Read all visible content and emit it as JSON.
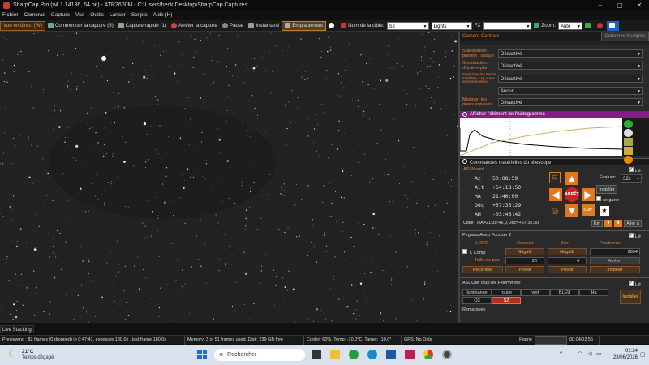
{
  "window": {
    "title": "SharpCap Pro (v4.1.14136, 64 bit) - ATR2600M - C:\\Users\\beck\\Desktop\\SharpCap Captures"
  },
  "menu": [
    "Fichier",
    "Caméras",
    "Capture",
    "Vue",
    "Outils",
    "Lancer",
    "Scripts",
    "Aide (H)"
  ],
  "toolbar": {
    "live_view": "Vue en direct (W)",
    "start_capture": "Commencer la capture (5)",
    "quick_capture": "Capture rapide (1)",
    "stop_capture": "Arrêter la capture",
    "pause": "Pause",
    "snapshot": "Instantané",
    "location": "Emplacement",
    "target_label": "Nom de la cible:",
    "target_value": "S2",
    "frame_type": "Lights",
    "fx_label": "FX",
    "zoom_label": "Zoom:",
    "zoom_value": "Auto"
  },
  "camera_controls": {
    "title": "Camera Controls",
    "multi_columns": "Colonnes multiples",
    "rows": [
      {
        "label": "Stabilisation planète / disque",
        "value": "Désactivé"
      },
      {
        "label": "Soustraction d'arrière-plan",
        "value": "Désactivé"
      },
      {
        "label": "Supprimer les traces satellites + sp upres la tombée de la",
        "value": "Désactivé"
      },
      {
        "label": "",
        "value": "Aucun"
      },
      {
        "label": "Masquer les pixels exposés",
        "value": "Désactivé"
      }
    ]
  },
  "histogram": {
    "title": "Afficher l'élément de l'histogramme"
  },
  "telescope": {
    "title": "Commandes matérielles du télescope",
    "mount_name": "ASI Mount",
    "connected_label": "Lié",
    "coords": [
      {
        "k": "Az",
        "v": "50:08:59"
      },
      {
        "k": "Alt",
        "v": "+54:18:50"
      },
      {
        "k": "HA",
        "v": "21:40:00"
      },
      {
        "k": "Déc",
        "v": "+57:35:29"
      },
      {
        "k": "AH",
        "v": "-03:46:42"
      }
    ],
    "rate_label": "Évaluer:",
    "rate_value": "32x",
    "install_btn": "Installer",
    "park_label": "se garer",
    "stop_btn": "ARRÊT",
    "follow_btn": "Suiv.",
    "target_text": "Cible : RA=21:39:46,0,Dec=+57:35:30",
    "goto_btn": "Em",
    "go_to_btn": "Aller à"
  },
  "focuser": {
    "name": "PegasusAstro Focuser 2",
    "connected_label": "Lié",
    "temp": "0,00°C",
    "coarse_label": "Grossier",
    "fine_label": "Bien",
    "position_label": "Positionner",
    "tcomp_label": "T. Comp",
    "neg1": "Négatif",
    "neg2": "Négatif",
    "position_value": "2694",
    "step_label": "Taille de pas",
    "step1": "25",
    "step2": "4",
    "stop_btn": "Arrêter",
    "refocus_btn": "Recentrer",
    "pos1": "Positif",
    "pos2": "Positif",
    "install_btn": "Installer"
  },
  "filterwheel": {
    "name": "ASCOM ToupTek FilterWheel",
    "connected_label": "Lié",
    "filters_row1": [
      "luminance",
      "rouge",
      "vert",
      "BLEU",
      "Ha"
    ],
    "filters_row2": [
      "O3",
      "S2"
    ],
    "selected": "S2",
    "install_btn": "Installer",
    "notes_label": "Remarques"
  },
  "live_stacking": "Live Stacking",
  "statusbar": {
    "preview": "Previewing : 82 frames (0 dropped) in 0:47:41, exposure 180,0s , last frame 180,0s",
    "memory": "Memory: 3 of 51 frames used, Disk: 239 GB free",
    "cooler": "Cooler: 60%, Temp: -10,0°C, Target: -10,0°",
    "gps": "GPS: No Data",
    "frame_label": "Frame",
    "elapsed": "00:04/02:56"
  },
  "taskbar": {
    "temp": "21°C",
    "weather": "Temps dégagé",
    "search": "Rechercher",
    "time": "01:24",
    "date": "23/06/2026"
  },
  "colors": {
    "accent": "#e07820",
    "histogram_header": "#8a1a8a"
  }
}
